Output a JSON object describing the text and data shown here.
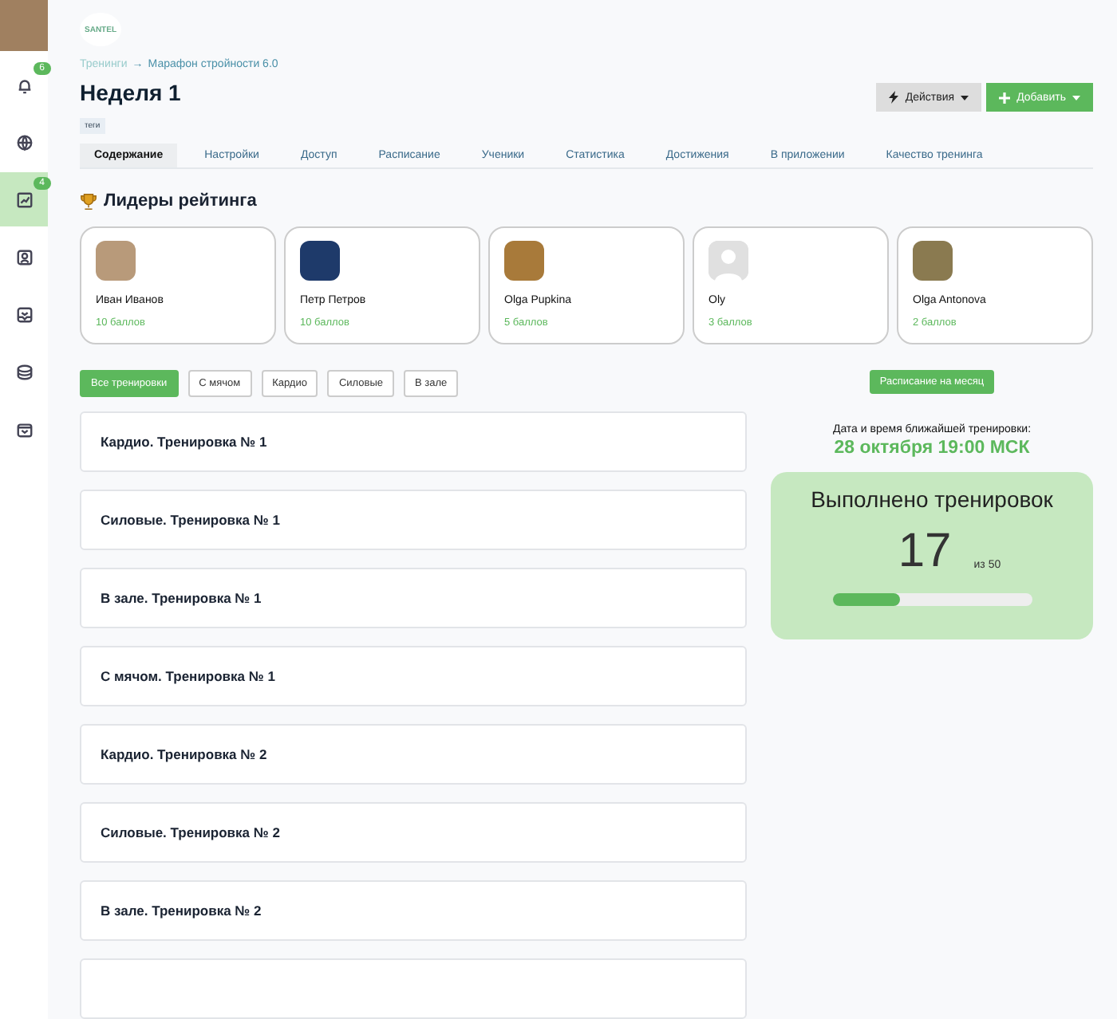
{
  "sidebar": {
    "items": [
      {
        "badge": "6",
        "selected": false
      },
      {
        "selected": false
      },
      {
        "badge": "4",
        "selected": true
      },
      {
        "selected": false
      },
      {
        "selected": false
      },
      {
        "selected": false
      },
      {
        "selected": false
      }
    ]
  },
  "logo": "SANTEL",
  "breadcrumb": [
    "Тренинги",
    "→",
    "Марафон стройности 6.0"
  ],
  "title": "Неделя 1",
  "tag": "теги",
  "actions": [
    {
      "label": "Действия",
      "kind": "secondary"
    },
    {
      "label": "Добавить",
      "kind": "primary"
    }
  ],
  "tabs": [
    {
      "label": "Содержание",
      "selected": true
    },
    {
      "label": "Настройки",
      "selected": false
    },
    {
      "label": "Доступ",
      "selected": false
    },
    {
      "label": "Расписание",
      "selected": false
    },
    {
      "label": "Ученики",
      "selected": false
    },
    {
      "label": "Статистика",
      "selected": false
    },
    {
      "label": "Достижения",
      "selected": false
    },
    {
      "label": "В приложении",
      "selected": false
    },
    {
      "label": "Качество тренинга",
      "selected": false
    }
  ],
  "leaders": {
    "title": "Лидеры рейтинга",
    "items": [
      {
        "name": "Иван Иванов",
        "points": "10 баллов",
        "kind": "photo",
        "color": "#b89a7a"
      },
      {
        "name": "Петр Петров",
        "points": "10 баллов",
        "kind": "photo",
        "color": "#1e3a6a"
      },
      {
        "name": "Olga Pupkina",
        "points": "5 баллов",
        "kind": "photo",
        "color": "#a87a3a"
      },
      {
        "name": "Oly",
        "points": "3 баллов",
        "kind": "silhouette",
        "color": "#e0e0e0"
      },
      {
        "name": "Olga Antonova",
        "points": "2 баллов",
        "kind": "photo",
        "color": "#8a7a50"
      }
    ]
  },
  "filters": [
    {
      "label": "Все тренировки",
      "selected": true
    },
    {
      "label": "С мячом",
      "selected": false
    },
    {
      "label": "Кардио",
      "selected": false
    },
    {
      "label": "Силовые",
      "selected": false
    },
    {
      "label": "В зале",
      "selected": false
    }
  ],
  "workouts": [
    "Кардио. Тренировка № 1",
    "Силовые. Тренировка № 1",
    "В зале. Тренировка № 1",
    "С мячом. Тренировка № 1",
    "Кардио. Тренировка № 2",
    "Силовые. Тренировка № 2",
    "В зале. Тренировка № 2"
  ],
  "schedule_button": "Расписание на месяц",
  "next": {
    "label": "Дата и время ближайшей тренировки:",
    "value": "28 октября 19:00 МСК"
  },
  "progress": {
    "title": "Выполнено тренировок",
    "count": "17",
    "total": "из 50",
    "level": 0.34
  }
}
